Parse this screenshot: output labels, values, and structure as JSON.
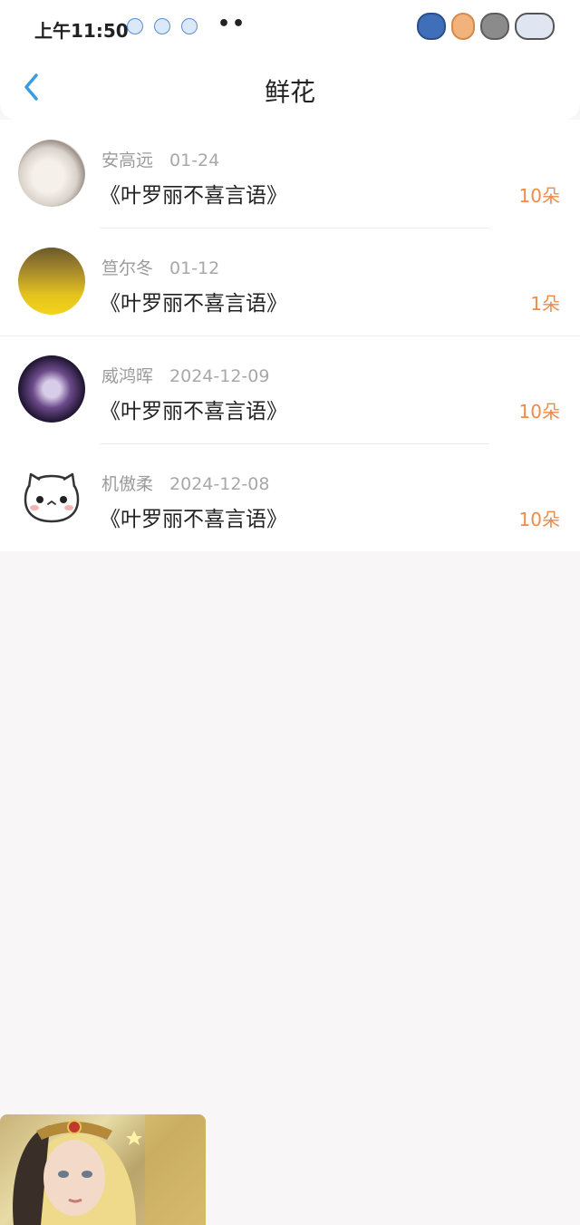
{
  "status": {
    "time": "上午11:50",
    "more": "••"
  },
  "header": {
    "title": "鲜花"
  },
  "rows": [
    {
      "name": "安高远",
      "date": "01-24",
      "book": "《叶罗丽不喜言语》",
      "count": "10朵"
    },
    {
      "name": "笪尔冬",
      "date": "01-12",
      "book": "《叶罗丽不喜言语》",
      "count": "1朵"
    },
    {
      "name": "威鸿晖",
      "date": "2024-12-09",
      "book": "《叶罗丽不喜言语》",
      "count": "10朵"
    },
    {
      "name": "机傲柔",
      "date": "2024-12-08",
      "book": "《叶罗丽不喜言语》",
      "count": "10朵"
    }
  ],
  "colors": {
    "accent": "#ef8a48",
    "back_arrow": "#3a9de0",
    "background": "#f8f6f7"
  }
}
